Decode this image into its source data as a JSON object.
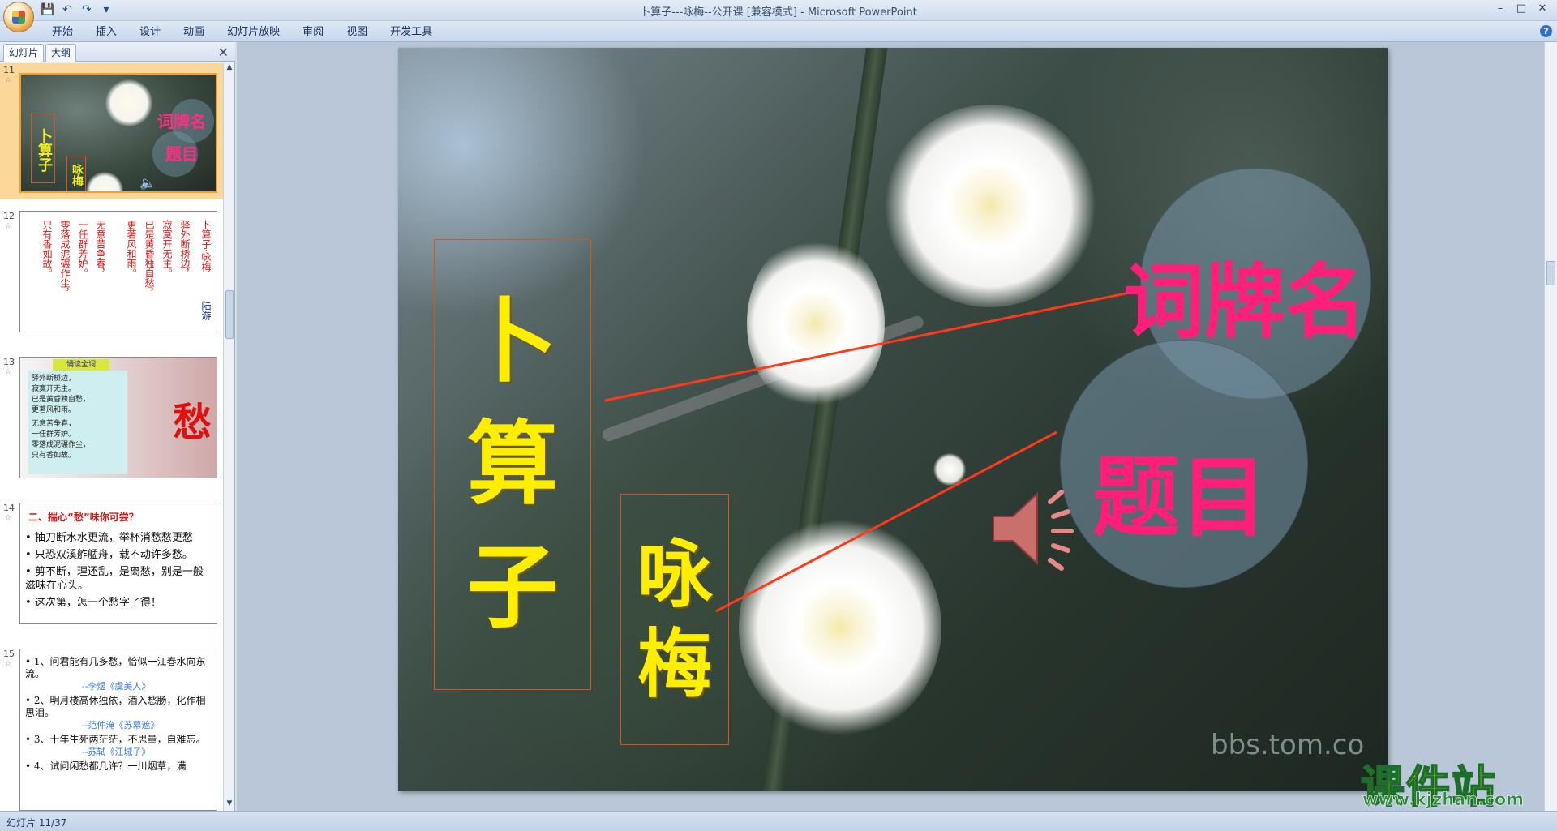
{
  "window": {
    "title": "卜算子---咏梅--公开课 [兼容模式] - Microsoft PowerPoint",
    "controls": [
      "–",
      "□",
      "✕"
    ]
  },
  "ribbon": {
    "tabs": [
      "开始",
      "插入",
      "设计",
      "动画",
      "幻灯片放映",
      "审阅",
      "视图",
      "开发工具"
    ]
  },
  "pane": {
    "tab_slides": "幻灯片",
    "tab_outline": "大纲",
    "close": "✕"
  },
  "thumbnails": {
    "s11": {
      "num": "11",
      "title": [
        "卜",
        "算",
        "子"
      ],
      "sub": [
        "咏",
        "梅"
      ],
      "l1": "词牌名",
      "l2": "题目"
    },
    "s12": {
      "num": "12",
      "title": "卜算子·咏梅",
      "author": "陆游",
      "columns": [
        "驿外断桥边，",
        "寂寞开无主。",
        "已是黄昏独自愁，",
        "更著风和雨。",
        "无意苦争春，",
        "一任群芳妒。",
        "零落成泥碾作尘，",
        "只有香如故。"
      ]
    },
    "s13": {
      "num": "13",
      "header": "诵读全词",
      "lines": [
        "驿外断桥边，",
        "寂寞开无主。",
        "已是黄昏独自愁，",
        "更著风和雨。",
        "无意苦争春，",
        "一任群芳妒。",
        "零落成泥碾作尘，",
        "只有香如故。"
      ],
      "big_char": "愁"
    },
    "s14": {
      "num": "14",
      "heading": "二、揣心“愁”味你可尝？",
      "bullets": [
        "抽刀断水水更流，举杯消愁愁更愁",
        "只恐双溪舴艋舟，载不动许多愁。",
        "剪不断，理还乱，是离愁，别是一般滋味在心头。",
        "这次第，怎一个愁字了得！"
      ]
    },
    "s15": {
      "num": "15",
      "items": [
        {
          "text": "1、问君能有几多愁，恰似一江春水向东流。",
          "src": "--李煜《虞美人》"
        },
        {
          "text": "2、明月楼高休独依，酒入愁肠，化作相思泪。",
          "src": "--范仲淹《苏幕遮》"
        },
        {
          "text": "3、十年生死两茫茫，不思量，自难忘。",
          "src": "--苏轼《江城子》"
        },
        {
          "text": "4、试问闲愁都几许？一川烟草，满",
          "src": ""
        }
      ]
    }
  },
  "slide": {
    "title_chars": [
      "卜",
      "算",
      "子"
    ],
    "subtitle_chars": [
      "咏",
      "梅"
    ],
    "label_cipaiming": "词牌名",
    "label_timu": "题目",
    "watermark": "bbs.tom.co",
    "speaker_icon": "speaker-icon"
  },
  "logo": {
    "name": "课件站",
    "url": "www.kjzhan.com"
  },
  "status": {
    "slide_info": "幻灯片 11/37"
  },
  "colors": {
    "title_yellow": "#ffee00",
    "label_pink": "#ff1f7a",
    "leader_line": "#ff3a1a",
    "selection": "#fbd89a"
  }
}
